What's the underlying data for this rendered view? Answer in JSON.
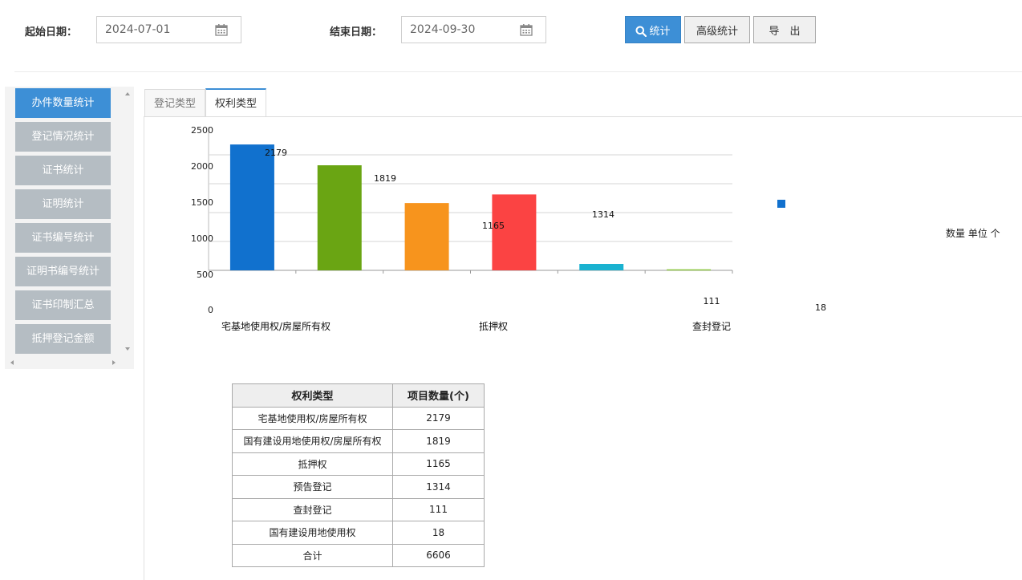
{
  "filters": {
    "start_label": "起始日期：",
    "start_value": "2024-07-01",
    "end_label": "结束日期：",
    "end_value": "2024-09-30",
    "stat_button": "统计",
    "advanced_button": "高级统计",
    "export_button": "导　出"
  },
  "sidebar": {
    "items": [
      {
        "label": "办件数量统计"
      },
      {
        "label": "登记情况统计"
      },
      {
        "label": "证书统计"
      },
      {
        "label": "证明统计"
      },
      {
        "label": "证书编号统计"
      },
      {
        "label": "证明书编号统计"
      },
      {
        "label": "证书印制汇总"
      },
      {
        "label": "抵押登记金额"
      }
    ]
  },
  "tabs": [
    {
      "label": "登记类型"
    },
    {
      "label": "权利类型"
    }
  ],
  "unit_label": "数量 单位 个",
  "colors": {
    "accent": "#3d8fd6",
    "sidebar_inactive": "#b5bdc3"
  },
  "chart_data": {
    "type": "bar",
    "categories": [
      "宅基地使用权/房屋所有权",
      "国有建设用地使用权/房屋所有权",
      "抵押权",
      "预告登记",
      "查封登记",
      "国有建设用地使用权"
    ],
    "visible_category_labels": [
      "宅基地使用权/房屋所有权",
      "抵押权",
      "查封登记"
    ],
    "values": [
      2179,
      1819,
      1165,
      1314,
      111,
      18
    ],
    "colors": [
      "#1171ce",
      "#6aa513",
      "#f7941d",
      "#fb4343",
      "#1ab2d0",
      "#8cc63f"
    ],
    "y_ticks": [
      "2500",
      "2000",
      "1500",
      "1000",
      "500",
      "0"
    ],
    "ylim": [
      0,
      2500
    ],
    "grid": true,
    "legend_marker_color": "#1171ce"
  },
  "table": {
    "headers": [
      "权利类型",
      "项目数量(个)"
    ],
    "rows": [
      [
        "宅基地使用权/房屋所有权",
        "2179"
      ],
      [
        "国有建设用地使用权/房屋所有权",
        "1819"
      ],
      [
        "抵押权",
        "1165"
      ],
      [
        "预告登记",
        "1314"
      ],
      [
        "查封登记",
        "111"
      ],
      [
        "国有建设用地使用权",
        "18"
      ],
      [
        "合计",
        "6606"
      ]
    ]
  }
}
